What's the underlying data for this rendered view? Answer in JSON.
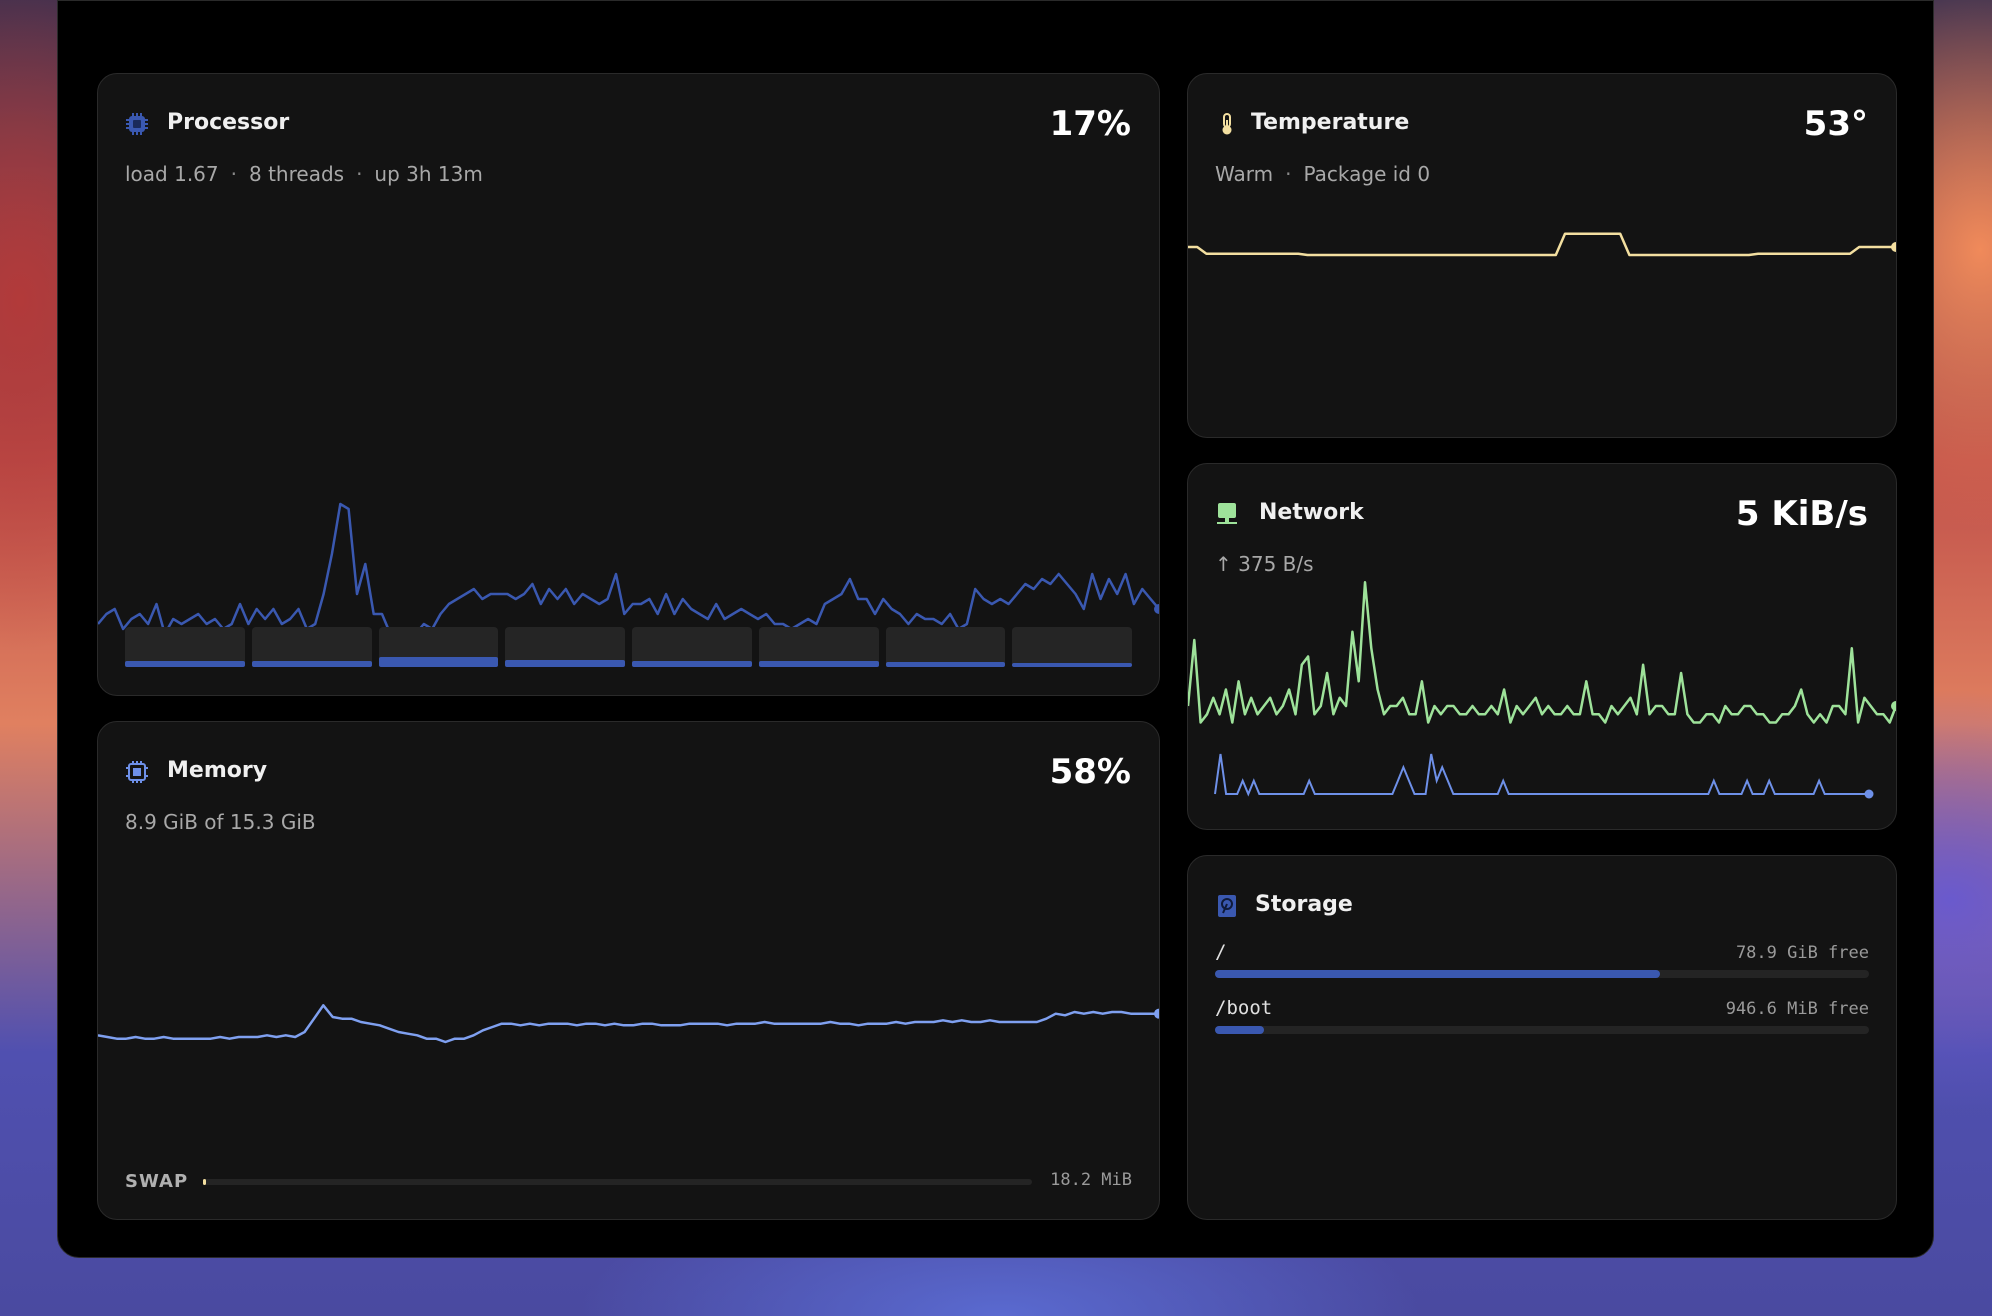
{
  "colors": {
    "cpu": "#3a58b0",
    "memory": "#7fa0f0",
    "temperature": "#f3dfa0",
    "network_down": "#9ee29a",
    "network_up": "#6e90e8"
  },
  "processor": {
    "title": "Processor",
    "icon": "cpu-icon",
    "value": "17%",
    "load": "load 1.67",
    "threads": "8 threads",
    "uptime": "up 3h 13m",
    "history": [
      12,
      14,
      15,
      11,
      13,
      14,
      12,
      16,
      10,
      13,
      12,
      13,
      14,
      12,
      13,
      11,
      12,
      16,
      12,
      15,
      13,
      15,
      12,
      13,
      15,
      11,
      12,
      18,
      26,
      36,
      35,
      18,
      24,
      14,
      14,
      10,
      9,
      9,
      10,
      12,
      11,
      14,
      16,
      17,
      18,
      19,
      17,
      18,
      18,
      18,
      17,
      18,
      20,
      16,
      19,
      17,
      19,
      16,
      18,
      17,
      16,
      17,
      22,
      14,
      16,
      16,
      17,
      14,
      18,
      14,
      17,
      15,
      14,
      13,
      16,
      13,
      14,
      15,
      14,
      13,
      14,
      12,
      12,
      11,
      12,
      13,
      12,
      16,
      17,
      18,
      21,
      17,
      17,
      14,
      17,
      15,
      14,
      12,
      14,
      13,
      13,
      12,
      14,
      11,
      12,
      19,
      17,
      16,
      17,
      16,
      18,
      20,
      19,
      21,
      20,
      22,
      20,
      18,
      15,
      22,
      17,
      21,
      18,
      22,
      16,
      19,
      17,
      15
    ],
    "thread_loads": [
      0.1,
      0.1,
      0.17,
      0.11,
      0.1,
      0.1,
      0.08,
      0.06
    ]
  },
  "memory": {
    "title": "Memory",
    "icon": "memory-chip-icon",
    "value": "58%",
    "detail": "8.9 GiB of 15.3 GiB",
    "history": [
      57.2,
      57.1,
      57.0,
      57.0,
      57.1,
      57.0,
      57.0,
      57.1,
      57.0,
      57.0,
      57.0,
      57.0,
      57.0,
      57.1,
      57.0,
      57.1,
      57.1,
      57.1,
      57.2,
      57.1,
      57.2,
      57.1,
      57.4,
      58.2,
      59.0,
      58.3,
      58.2,
      58.2,
      58.0,
      57.9,
      57.8,
      57.6,
      57.4,
      57.3,
      57.2,
      57.0,
      57.0,
      56.8,
      57.0,
      57.0,
      57.2,
      57.5,
      57.7,
      57.9,
      57.9,
      57.8,
      57.9,
      57.8,
      57.9,
      57.9,
      57.9,
      57.8,
      57.9,
      57.9,
      57.8,
      57.9,
      57.8,
      57.8,
      57.9,
      57.9,
      57.8,
      57.8,
      57.8,
      57.9,
      57.9,
      57.9,
      57.9,
      57.8,
      57.9,
      57.9,
      57.9,
      58.0,
      57.9,
      57.9,
      57.9,
      57.9,
      57.9,
      57.9,
      58.0,
      57.9,
      57.9,
      57.8,
      57.9,
      57.9,
      57.9,
      58.0,
      57.9,
      58.0,
      58.0,
      58.0,
      58.1,
      58.0,
      58.1,
      58.0,
      58.0,
      58.1,
      58.0,
      58.0,
      58.0,
      58.0,
      58.0,
      58.2,
      58.5,
      58.4,
      58.6,
      58.5,
      58.6,
      58.5,
      58.6,
      58.6,
      58.5,
      58.5,
      58.5,
      58.5
    ],
    "swap_label": "SWAP",
    "swap_value": "18.2 MiB",
    "swap_fraction": 0.004
  },
  "temperature": {
    "title": "Temperature",
    "icon": "thermometer-icon",
    "value": "53°",
    "status": "Warm",
    "sensor": "Package id 0",
    "history": [
      53,
      53,
      52,
      52,
      52,
      52,
      52,
      52,
      52,
      52,
      52,
      52,
      52,
      51.8,
      51.8,
      51.8,
      51.8,
      51.8,
      51.8,
      51.8,
      51.8,
      51.8,
      51.8,
      51.8,
      51.8,
      51.8,
      51.8,
      51.8,
      51.8,
      51.8,
      51.8,
      51.8,
      51.8,
      51.8,
      51.8,
      51.8,
      51.8,
      51.8,
      51.8,
      51.8,
      51.8,
      55,
      55,
      55,
      55,
      55,
      55,
      55,
      51.8,
      51.8,
      51.8,
      51.8,
      51.8,
      51.8,
      51.8,
      51.8,
      51.8,
      51.8,
      51.8,
      51.8,
      51.8,
      51.8,
      52,
      52,
      52,
      52,
      52,
      52,
      52,
      52,
      52,
      52,
      52,
      53,
      53,
      53,
      53,
      53
    ]
  },
  "network": {
    "title": "Network",
    "icon": "network-icon",
    "value": "5 KiB/s",
    "upload": "↑ 375 B/s",
    "down_history": [
      4,
      12,
      2,
      3,
      5,
      3,
      6,
      2,
      7,
      3,
      5,
      3,
      4,
      5,
      3,
      4,
      6,
      3,
      9,
      10,
      3,
      4,
      8,
      3,
      5,
      4,
      13,
      7,
      19,
      11,
      6,
      3,
      4,
      4,
      5,
      3,
      3,
      7,
      2,
      4,
      3,
      4,
      4,
      3,
      3,
      4,
      3,
      3,
      4,
      3,
      6,
      2,
      4,
      3,
      4,
      5,
      3,
      4,
      3,
      3,
      4,
      3,
      3,
      7,
      3,
      3,
      2,
      4,
      3,
      4,
      5,
      3,
      9,
      3,
      4,
      4,
      3,
      3,
      8,
      3,
      2,
      2,
      3,
      3,
      2,
      4,
      3,
      3,
      4,
      4,
      3,
      3,
      2,
      2,
      3,
      3,
      4,
      6,
      3,
      2,
      3,
      2,
      4,
      4,
      3,
      11,
      2,
      5,
      4,
      3,
      3,
      2,
      4
    ],
    "up_history": [
      0,
      3,
      0,
      0,
      0,
      1,
      0,
      1,
      0,
      0,
      0,
      0,
      0,
      0,
      0,
      0,
      0,
      1,
      0,
      0,
      0,
      0,
      0,
      0,
      0,
      0,
      0,
      0,
      0,
      0,
      0,
      0,
      0,
      1,
      2,
      1,
      0,
      0,
      0,
      3,
      1,
      2,
      1,
      0,
      0,
      0,
      0,
      0,
      0,
      0,
      0,
      0,
      1,
      0,
      0,
      0,
      0,
      0,
      0,
      0,
      0,
      0,
      0,
      0,
      0,
      0,
      0,
      0,
      0,
      0,
      0,
      0,
      0,
      0,
      0,
      0,
      0,
      0,
      0,
      0,
      0,
      0,
      0,
      0,
      0,
      0,
      0,
      0,
      0,
      0,
      1,
      0,
      0,
      0,
      0,
      0,
      1,
      0,
      0,
      0,
      1,
      0,
      0,
      0,
      0,
      0,
      0,
      0,
      0,
      1,
      0,
      0,
      0,
      0,
      0,
      0,
      0,
      0,
      0
    ]
  },
  "storage": {
    "title": "Storage",
    "icon": "hard-drive-icon",
    "disks": [
      {
        "mount": "/",
        "free": "78.9 GiB free",
        "used_fraction": 0.68
      },
      {
        "mount": "/boot",
        "free": "946.6 MiB free",
        "used_fraction": 0.075
      }
    ]
  }
}
